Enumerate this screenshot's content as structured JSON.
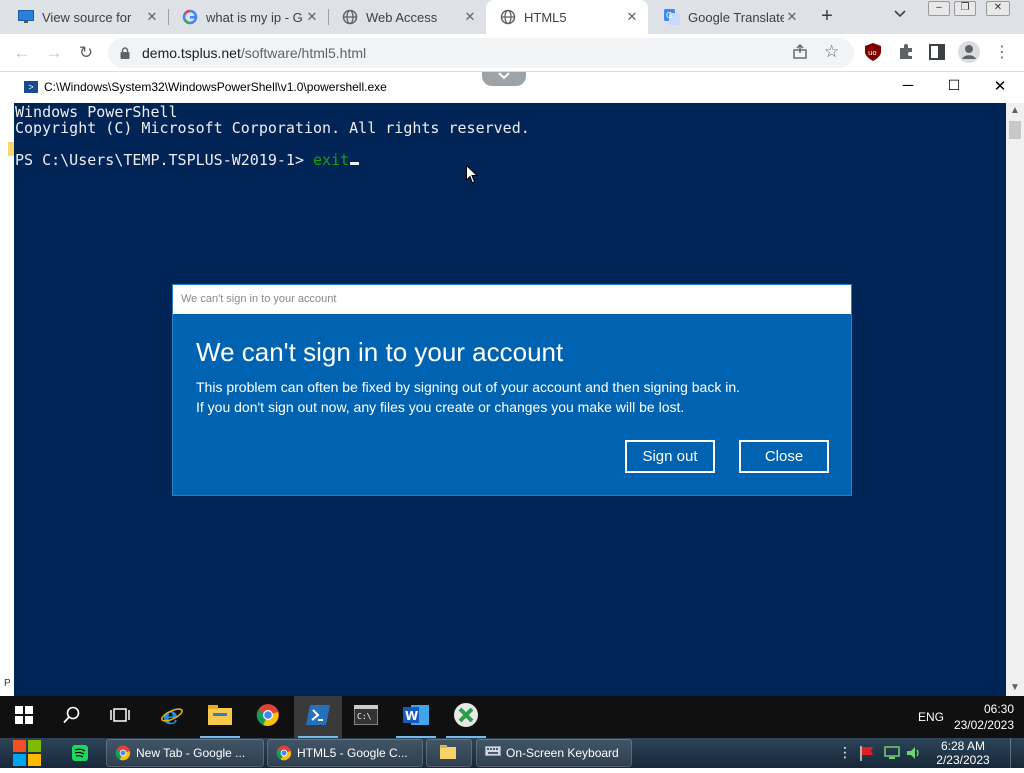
{
  "browser": {
    "tabs": [
      {
        "label": "View source for",
        "icon": "monitor-icon",
        "active": false
      },
      {
        "label": "what is my ip - G",
        "icon": "google-icon",
        "active": false
      },
      {
        "label": "Web Access",
        "icon": "globe-icon",
        "active": false
      },
      {
        "label": "HTML5",
        "icon": "globe-icon",
        "active": true
      },
      {
        "label": "Google Translate",
        "icon": "translate-icon",
        "active": false
      }
    ],
    "new_tab": "+",
    "url_host": "demo.tsplus.net",
    "url_path": "/software/html5.html"
  },
  "powershell": {
    "title": "C:\\Windows\\System32\\WindowsPowerShell\\v1.0\\powershell.exe",
    "line1": "Windows PowerShell",
    "line2": "Copyright (C) Microsoft Corporation. All rights reserved.",
    "prompt": "PS C:\\Users\\TEMP.TSPLUS-W2019-1> ",
    "command": "exit"
  },
  "dialog": {
    "titlebar": "We can't sign in to your account",
    "heading": "We can't sign in to your account",
    "message_line1": "This problem can often be fixed by signing out of your account and then signing back in.",
    "message_line2": "If you don't sign out now, any files you create or changes you make will be lost.",
    "sign_out": "Sign out",
    "close": "Close"
  },
  "remote_taskbar": {
    "language": "ENG",
    "time": "06:30",
    "date": "23/02/2023"
  },
  "local_taskbar": {
    "items": [
      {
        "label": "New Tab - Google ...",
        "icon": "chrome-icon"
      },
      {
        "label": "HTML5 - Google C...",
        "icon": "chrome-icon"
      },
      {
        "label": "",
        "icon": "folder-icon"
      },
      {
        "label": "On-Screen Keyboard",
        "icon": "keyboard-icon"
      }
    ],
    "time": "6:28 AM",
    "date": "2/23/2023"
  },
  "colors": {
    "powershell_bg": "#012456",
    "dialog_bg": "#0063b1",
    "command_green": "#13a10e"
  }
}
